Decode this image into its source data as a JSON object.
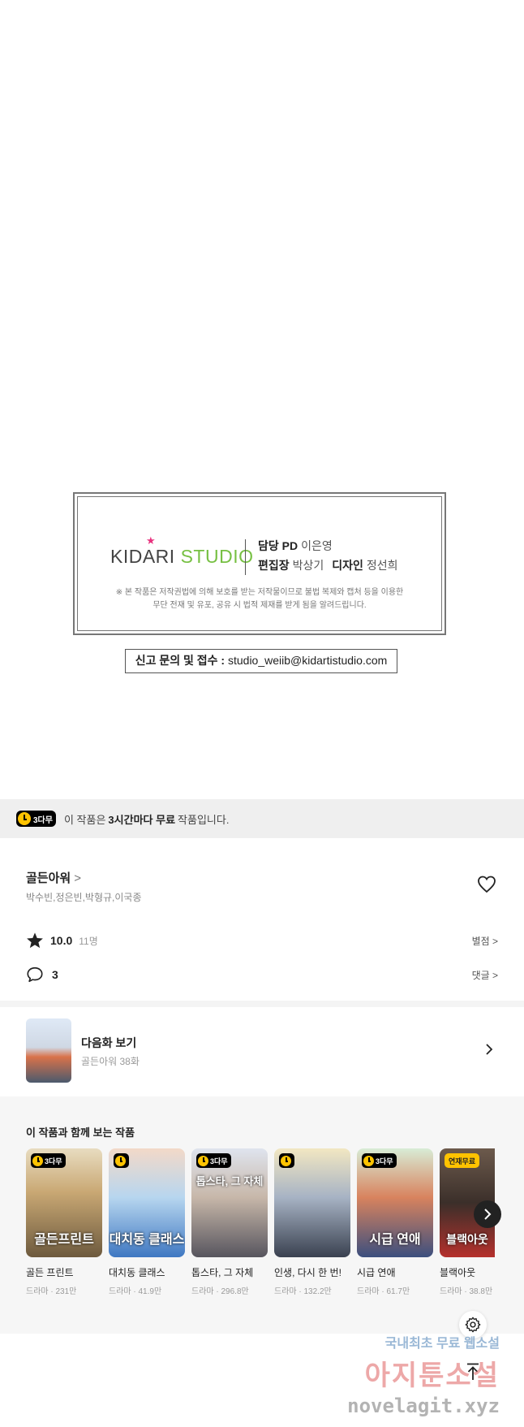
{
  "credits": {
    "logo_kid": "KIDARI",
    "logo_studio": "STUDIO",
    "pd_label": "담당 PD",
    "pd_name": "이은영",
    "editor_label": "편집장",
    "editor_name": "박상기",
    "design_label": "디자인",
    "design_name": "정선희",
    "notice_line1": "※ 본 작품은 저작권법에 의해 보호를 받는 저작물이므로 불법 복제와 캡처 등을 이용한",
    "notice_line2": "무단 전재 및 유포, 공유 시 법적 제재를 받게 됨을 알려드립니다.",
    "report_label": "신고 문의 및 접수 :",
    "report_email": "studio_weiib@kidartistudio.com"
  },
  "free_banner": {
    "badge": "3다무",
    "text_prefix": "이 작품은",
    "text_bold": "3시간마다 무료",
    "text_suffix": "작품입니다."
  },
  "title": {
    "name": "골든아워",
    "chevron": ">",
    "authors": "박수빈,정은빈,박형규,이국종"
  },
  "rating": {
    "score": "10.0",
    "count": "11명",
    "link": "별점 >"
  },
  "comments": {
    "count": "3",
    "link": "댓글 >"
  },
  "next_episode": {
    "title": "다음화 보기",
    "subtitle": "골든아워 38화"
  },
  "recommendations": {
    "title": "이 작품과 함께 보는 작품",
    "items": [
      {
        "name": "골든 프린트",
        "meta": "드라마 · 231만",
        "badge": "3다무",
        "cover_text": "골든프린트"
      },
      {
        "name": "대치동 클래스",
        "meta": "드라마 · 41.9만",
        "badge": "",
        "cover_text": "대치동 클래스"
      },
      {
        "name": "톱스타, 그 자체",
        "meta": "드라마 · 296.8만",
        "badge": "3다무",
        "cover_text": "톱스타, 그 자체"
      },
      {
        "name": "인생, 다시 한 번!",
        "meta": "드라마 · 132.2만",
        "badge": "",
        "cover_text": ""
      },
      {
        "name": "시급 연애",
        "meta": "드라마 · 61.7만",
        "badge": "3다무",
        "cover_text": "시급 연애"
      },
      {
        "name": "블랙아웃",
        "meta": "드라마 · 38.8만",
        "badge": "연재무료",
        "cover_text": "블랙아웃"
      }
    ]
  },
  "watermark": {
    "line1": "국내최초 무료 웹소설",
    "line2": "아지툰소설",
    "line3": "novelagit.xyz"
  },
  "colors": {
    "accent_yellow": "#ffc300",
    "brand_green": "#77c043",
    "brand_pink": "#e8327e"
  }
}
